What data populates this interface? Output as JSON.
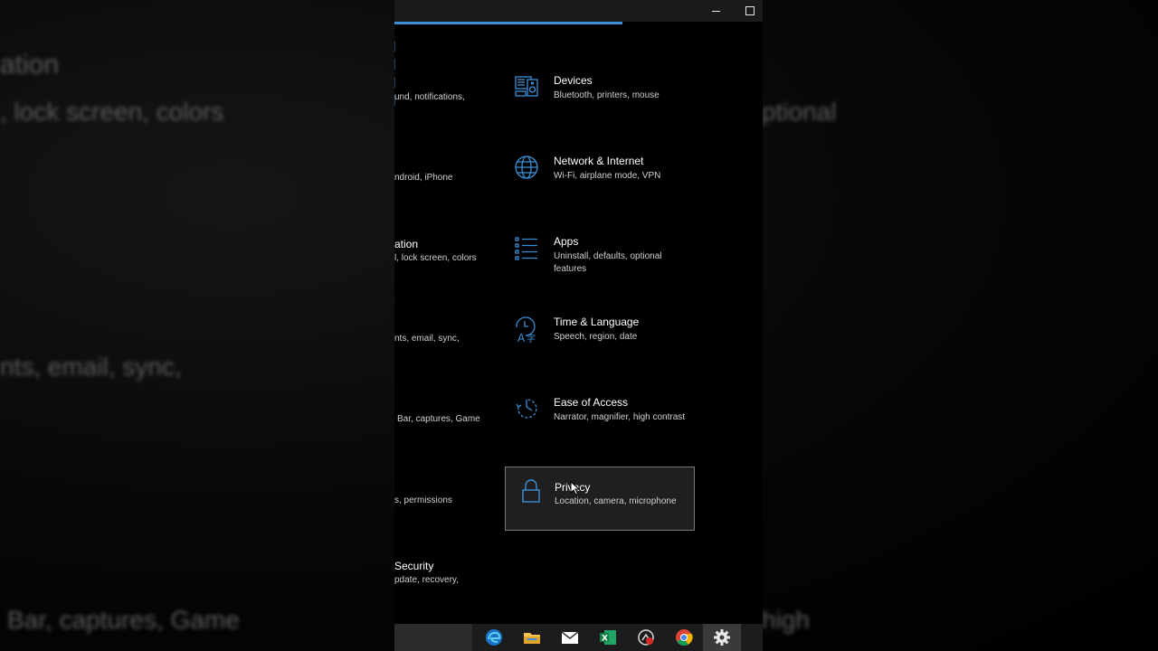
{
  "background": {
    "texts": [
      {
        "text": "ation"
      },
      {
        "text": ", lock screen, colors"
      },
      {
        "text": "ptional"
      },
      {
        "text": "nts, email, sync,"
      },
      {
        "text": "Bar, captures, Game"
      },
      {
        "text": "high"
      }
    ]
  },
  "window": {
    "title": "",
    "loading_progress": 0.62,
    "controls": {
      "minimize": "minimize",
      "maximize": "maximize"
    }
  },
  "left_column": [
    {
      "title": "",
      "desc": "und, notifications,"
    },
    {
      "title": "",
      "desc": "ndroid, iPhone"
    },
    {
      "title": "ation",
      "desc": "l, lock screen, colors"
    },
    {
      "title": "",
      "desc": "nts, email, sync,"
    },
    {
      "title": "",
      "desc": "Bar, captures, Game"
    },
    {
      "title": "",
      "desc": "s, permissions"
    },
    {
      "title": "Security",
      "desc": "pdate, recovery,"
    }
  ],
  "right_column": [
    {
      "icon": "devices-icon",
      "title": "Devices",
      "desc": "Bluetooth, printers, mouse"
    },
    {
      "icon": "globe-icon",
      "title": "Network & Internet",
      "desc": "Wi-Fi, airplane mode, VPN"
    },
    {
      "icon": "apps-list-icon",
      "title": "Apps",
      "desc": "Uninstall, defaults, optional features"
    },
    {
      "icon": "time-language-icon",
      "title": "Time & Language",
      "desc": "Speech, region, date"
    },
    {
      "icon": "ease-of-access-icon",
      "title": "Ease of Access",
      "desc": "Narrator, magnifier, high contrast"
    },
    {
      "icon": "lock-icon",
      "title": "Privacy",
      "desc": "Location, camera, microphone"
    }
  ],
  "taskbar": {
    "apps": [
      {
        "icon": "edge-icon"
      },
      {
        "icon": "file-explorer-icon"
      },
      {
        "icon": "mail-icon"
      },
      {
        "icon": "excel-icon"
      },
      {
        "icon": "media-app-icon"
      },
      {
        "icon": "chrome-icon"
      },
      {
        "icon": "settings-gear-icon"
      }
    ]
  },
  "colors": {
    "accent": "#3b8fd6",
    "background": "#000000",
    "hover_border": "#777777"
  }
}
